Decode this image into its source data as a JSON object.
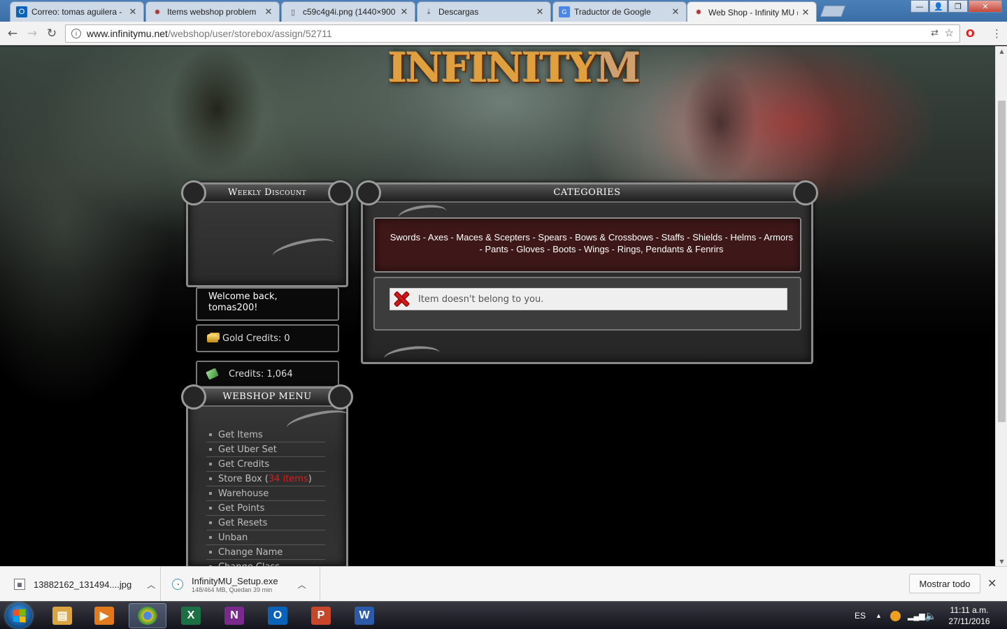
{
  "browser": {
    "tabs": [
      {
        "label": "Correo: tomas aguilera -",
        "icon": "outlook-icon"
      },
      {
        "label": "Items webshop problem",
        "icon": "infinitymu-icon"
      },
      {
        "label": "c59c4g4i.png (1440×900",
        "icon": "file-icon"
      },
      {
        "label": "Descargas",
        "icon": "download-icon"
      },
      {
        "label": "Traductor de Google",
        "icon": "google-translate-icon"
      },
      {
        "label": "Web Shop - Infinity MU (",
        "icon": "infinitymu-icon",
        "active": true
      }
    ],
    "window_controls": {
      "minimize": "—",
      "restore": "❐",
      "close": "✕"
    },
    "url_host": "www.infinitymu.net",
    "url_path": "/webshop/user/storebox/assign/52711"
  },
  "page": {
    "logo_main": "INFINITY",
    "logo_mu": "MU",
    "weekly_discount_title": "Weekly Discount",
    "welcome_text": "Welcome back, tomas200!",
    "gold_credits": "Gold Credits: 0",
    "credits": "Credits: 1,064",
    "webshop_menu_title": "WEBSHOP MENU",
    "menu": [
      "Get Items",
      "Get Uber Set",
      "Get Credits",
      "Store Box",
      "Warehouse",
      "Get Points",
      "Get Resets",
      "Unban",
      "Change Name",
      "Change Class"
    ],
    "storebox_count_open": " (",
    "storebox_count": "34 items",
    "storebox_count_close": ")",
    "categories_title": "CATEGORIES",
    "categories_line1": "Swords - Axes - Maces & Scepters - Spears - Bows & Crossbows - Staffs - Shields - Helms - Armors",
    "categories_line2": "- Pants - Gloves - Boots - Wings - Rings, Pendants & Fenrirs",
    "error_message": "Item doesn't belong to you."
  },
  "downloads": {
    "items": [
      {
        "name": "13882162_131494....jpg",
        "status": ""
      },
      {
        "name": "InfinityMU_Setup.exe",
        "status": "148/464 MB, Quedan 39 min"
      }
    ],
    "show_all": "Mostrar todo"
  },
  "taskbar": {
    "apps": [
      {
        "name": "explorer",
        "glyph": "▤",
        "color": "#d9a441"
      },
      {
        "name": "media-player",
        "glyph": "▶",
        "color": "#e07a1c"
      },
      {
        "name": "chrome",
        "glyph": "●",
        "color": "#2e9a3c",
        "active": true
      },
      {
        "name": "excel",
        "glyph": "X",
        "color": "#1d7044"
      },
      {
        "name": "onenote",
        "glyph": "N",
        "color": "#7a2a8c"
      },
      {
        "name": "outlook",
        "glyph": "O",
        "color": "#0a63b8"
      },
      {
        "name": "powerpoint",
        "glyph": "P",
        "color": "#c8462a"
      },
      {
        "name": "word",
        "glyph": "W",
        "color": "#2a5aa8"
      }
    ],
    "language": "ES",
    "time": "11:11 a.m.",
    "date": "27/11/2016"
  },
  "colors": {
    "accent_red": "#e01a1a",
    "categories_bg": "#3e1818"
  }
}
